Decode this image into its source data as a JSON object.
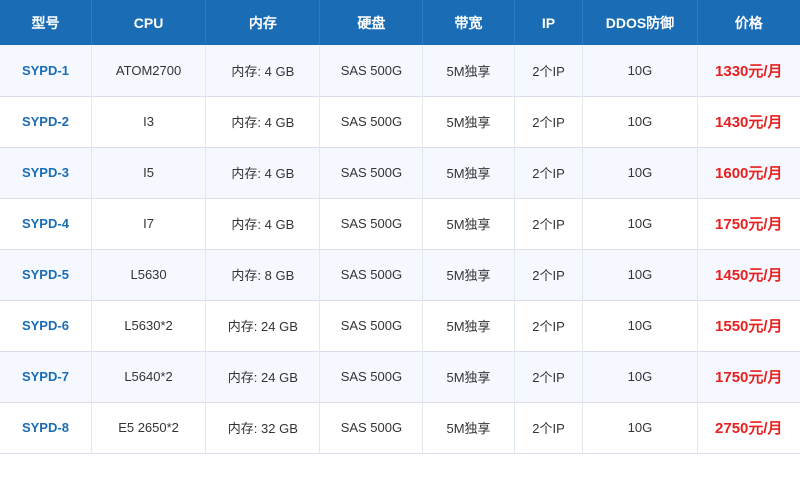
{
  "table": {
    "headers": [
      "型号",
      "CPU",
      "内存",
      "硬盘",
      "带宽",
      "IP",
      "DDOS防御",
      "价格"
    ],
    "rows": [
      {
        "model": "SYPD-1",
        "cpu": "ATOM2700",
        "mem": "内存: 4 GB",
        "disk": "SAS 500G",
        "bw": "5M独享",
        "ip": "2个IP",
        "ddos": "10G",
        "price": "1330元/月"
      },
      {
        "model": "SYPD-2",
        "cpu": "I3",
        "mem": "内存: 4 GB",
        "disk": "SAS 500G",
        "bw": "5M独享",
        "ip": "2个IP",
        "ddos": "10G",
        "price": "1430元/月"
      },
      {
        "model": "SYPD-3",
        "cpu": "I5",
        "mem": "内存: 4 GB",
        "disk": "SAS 500G",
        "bw": "5M独享",
        "ip": "2个IP",
        "ddos": "10G",
        "price": "1600元/月"
      },
      {
        "model": "SYPD-4",
        "cpu": "I7",
        "mem": "内存: 4 GB",
        "disk": "SAS 500G",
        "bw": "5M独享",
        "ip": "2个IP",
        "ddos": "10G",
        "price": "1750元/月"
      },
      {
        "model": "SYPD-5",
        "cpu": "L5630",
        "mem": "内存: 8 GB",
        "disk": "SAS 500G",
        "bw": "5M独享",
        "ip": "2个IP",
        "ddos": "10G",
        "price": "1450元/月"
      },
      {
        "model": "SYPD-6",
        "cpu": "L5630*2",
        "mem": "内存: 24 GB",
        "disk": "SAS 500G",
        "bw": "5M独享",
        "ip": "2个IP",
        "ddos": "10G",
        "price": "1550元/月"
      },
      {
        "model": "SYPD-7",
        "cpu": "L5640*2",
        "mem": "内存: 24 GB",
        "disk": "SAS 500G",
        "bw": "5M独享",
        "ip": "2个IP",
        "ddos": "10G",
        "price": "1750元/月"
      },
      {
        "model": "SYPD-8",
        "cpu": "E5 2650*2",
        "mem": "内存: 32 GB",
        "disk": "SAS 500G",
        "bw": "5M独享",
        "ip": "2个IP",
        "ddos": "10G",
        "price": "2750元/月"
      }
    ]
  }
}
